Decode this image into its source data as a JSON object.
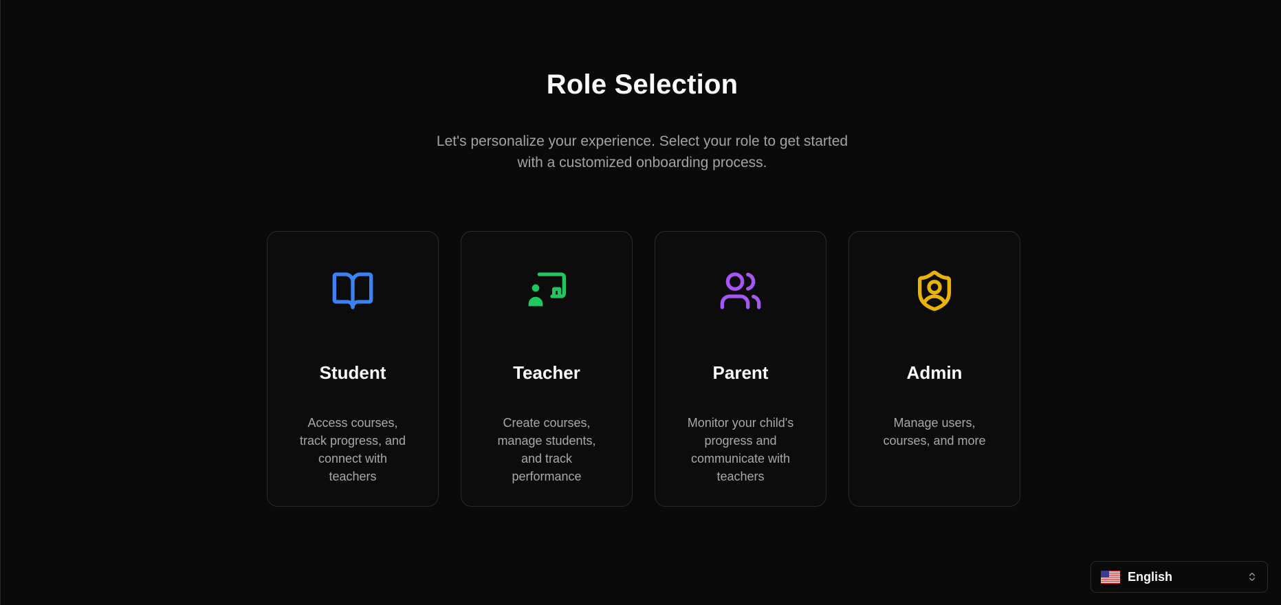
{
  "header": {
    "title": "Role Selection",
    "subtitle": "Let's personalize your experience. Select your role to get started with a customized onboarding process."
  },
  "roles": [
    {
      "title": "Student",
      "description": "Access courses, track progress, and connect with teachers",
      "icon": "book-open-icon",
      "color": "#3b82f6"
    },
    {
      "title": "Teacher",
      "description": "Create courses, manage students, and track performance",
      "icon": "presentation-icon",
      "color": "#22c55e"
    },
    {
      "title": "Parent",
      "description": "Monitor your child's progress and communicate with teachers",
      "icon": "users-icon",
      "color": "#a855f7"
    },
    {
      "title": "Admin",
      "description": "Manage users, courses, and more",
      "icon": "shield-user-icon",
      "color": "#eab308"
    }
  ],
  "language_selector": {
    "selected": "English",
    "flag_icon": "us-flag-icon",
    "chevron_icon": "chevrons-up-down-icon"
  }
}
